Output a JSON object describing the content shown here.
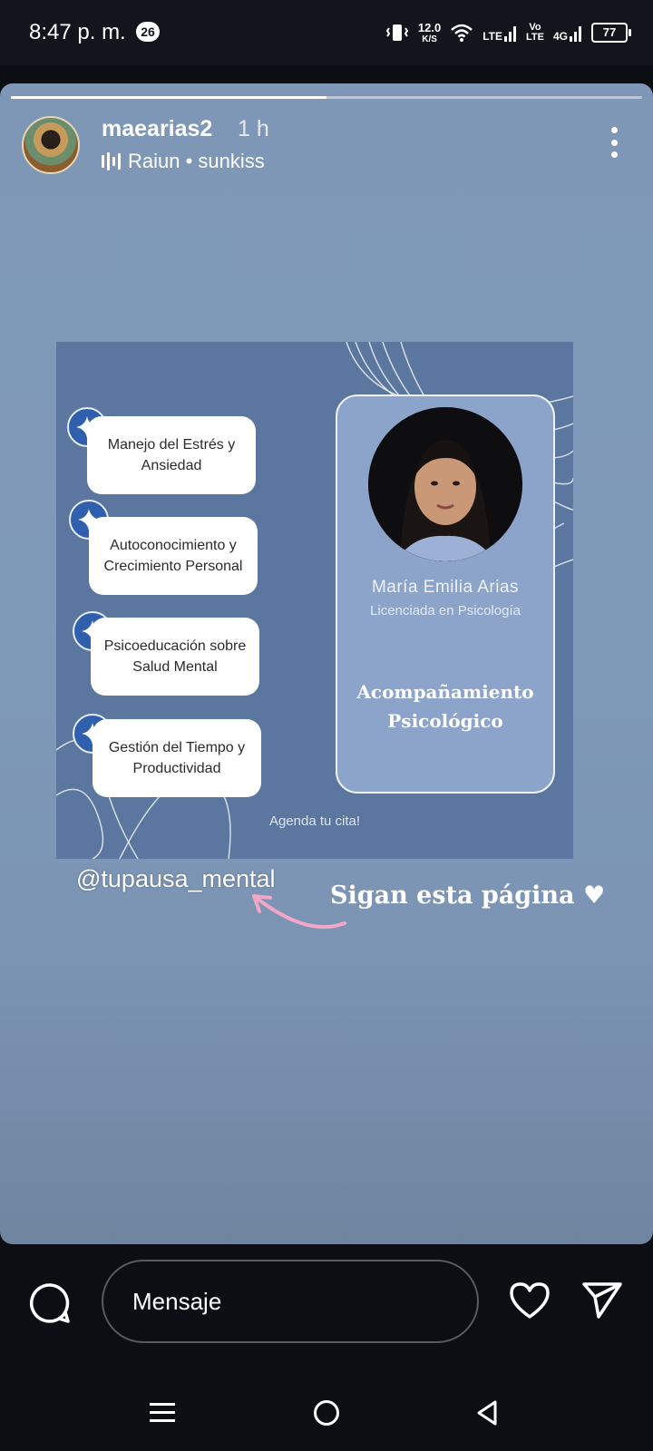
{
  "status_bar": {
    "time": "8:47 p. m.",
    "notification_count": "26",
    "speed_value": "12.0",
    "speed_unit": "K/S",
    "network_1": "LTE",
    "network_2_top": "Vo",
    "network_2_bottom": "LTE",
    "network_3": "4G",
    "battery": "77"
  },
  "story": {
    "progress": 0.5,
    "username": "maearias2",
    "time_ago": "1 h",
    "music": "Raiun • sunkiss"
  },
  "post": {
    "services": [
      "Manejo del Estrés y Ansiedad",
      "Autoconocimiento y Crecimiento Personal",
      "Psicoeducación sobre Salud Mental",
      "Gestión del Tiempo y Productividad"
    ],
    "name": "María Emilia Arias",
    "role": "Licenciada en Psicología",
    "headline_line1": "Acompañamiento",
    "headline_line2": "Psicológico",
    "cta": "Agenda tu cita!",
    "colors": {
      "card": "#5b77a0",
      "panel": "#8ca4c9",
      "badge": "#2f5fad"
    }
  },
  "overlay": {
    "mention": "@tupausa_mental",
    "follow": "Sigan esta página ♥",
    "arrow_color": "#f2a6c8"
  },
  "message_bar": {
    "placeholder": "Mensaje"
  },
  "icons": {
    "chat": "chat-bubble-icon",
    "like": "heart-icon",
    "share": "send-icon",
    "more": "more-vertical-icon"
  }
}
